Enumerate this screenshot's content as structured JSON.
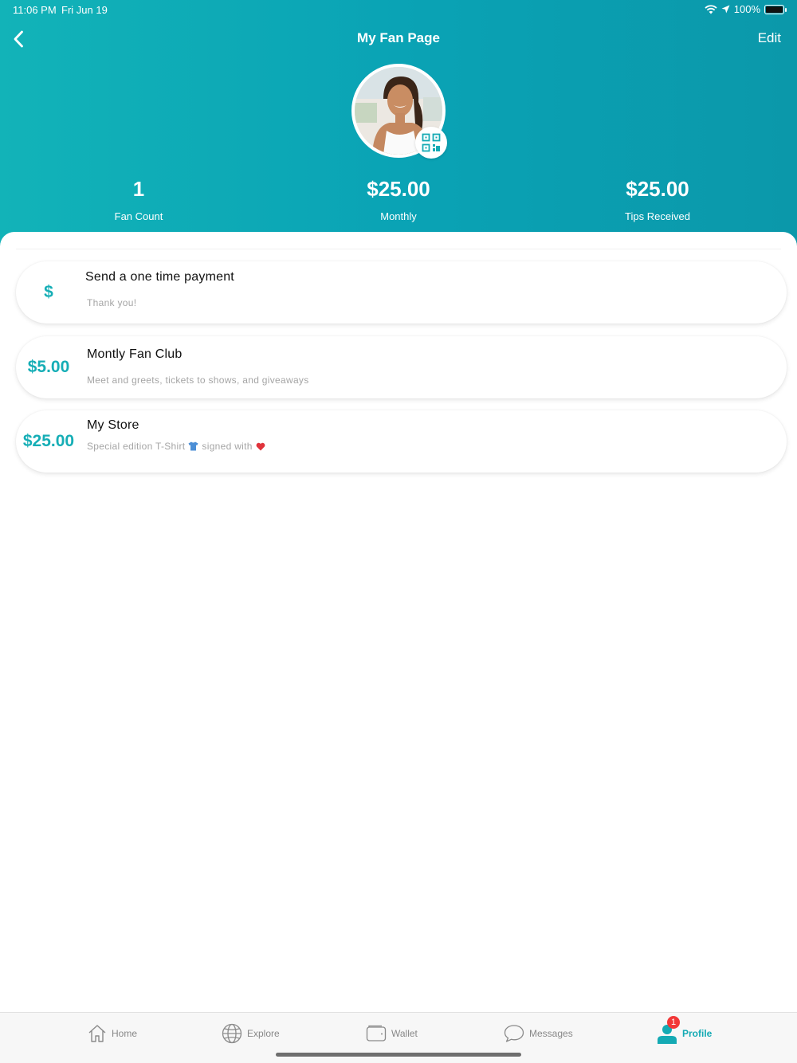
{
  "status_bar": {
    "time": "11:06 PM",
    "date": "Fri Jun 19",
    "battery": "100%"
  },
  "nav": {
    "title": "My Fan Page",
    "edit_label": "Edit",
    "back_icon": "chevron-left-icon"
  },
  "profile": {
    "qr_icon": "qr-code-icon"
  },
  "stats": [
    {
      "value": "1",
      "label": "Fan Count"
    },
    {
      "value": "$25.00",
      "label": "Monthly"
    },
    {
      "value": "$25.00",
      "label": "Tips Received"
    }
  ],
  "cards": [
    {
      "amount": "$",
      "title": "Send a one time payment",
      "subtitle": "Thank you!"
    },
    {
      "amount": "$5.00",
      "title": "Montly Fan Club",
      "subtitle": "Meet and greets, tickets to shows, and giveaways"
    },
    {
      "amount": "$25.00",
      "title": "My Store",
      "subtitle_prefix": "Special edition T-Shirt",
      "subtitle_mid": "signed with"
    }
  ],
  "tabs": [
    {
      "label": "Home",
      "icon": "home-icon"
    },
    {
      "label": "Explore",
      "icon": "globe-icon"
    },
    {
      "label": "Wallet",
      "icon": "wallet-icon"
    },
    {
      "label": "Messages",
      "icon": "chat-bubble-icon"
    },
    {
      "label": "Profile",
      "icon": "user-icon",
      "badge": "1",
      "active": true
    }
  ],
  "colors": {
    "accent": "#14aab4",
    "header_start": "#12b3b8",
    "header_end": "#0b98aa",
    "badge": "#f23838"
  }
}
